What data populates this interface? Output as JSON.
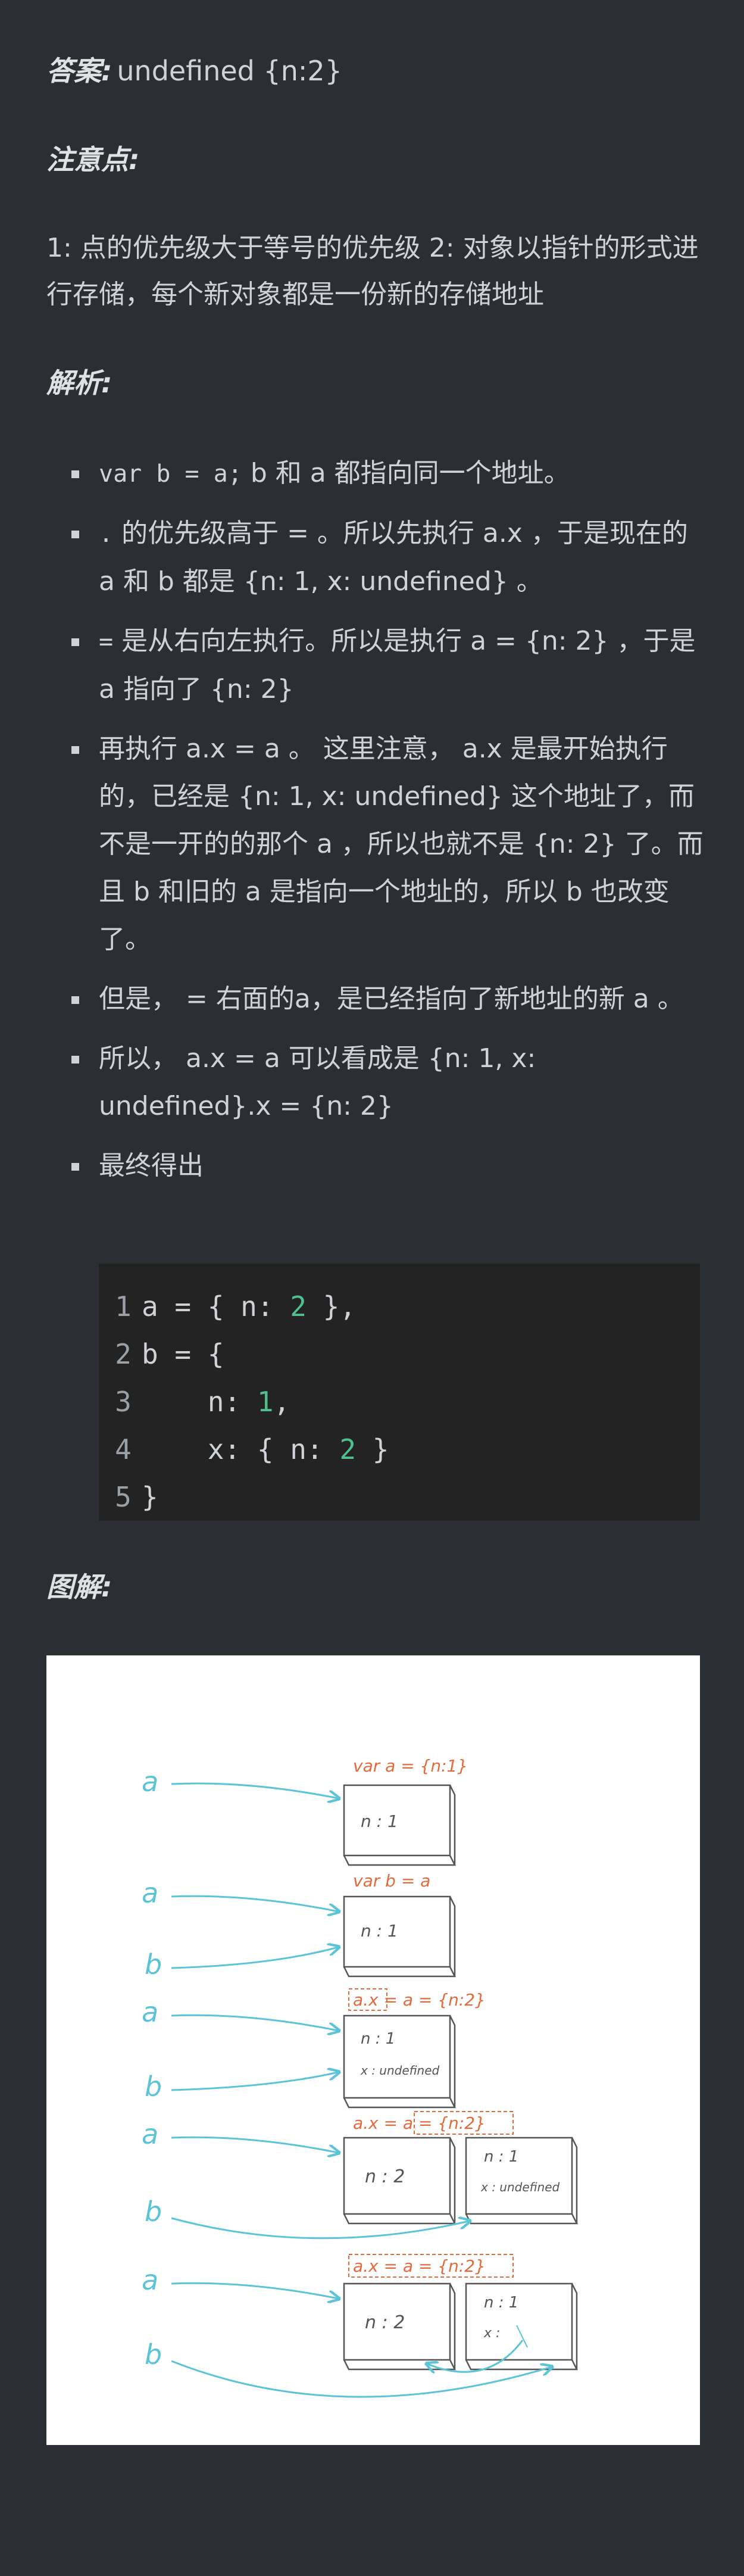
{
  "answer": {
    "label": "答案:",
    "value": "undefined {n:2}"
  },
  "notes": {
    "label": "注意点:",
    "text": "1: 点的优先级大于等号的优先级 2: 对象以指针的形式进行存储，每个新对象都是一份新的存储地址"
  },
  "analysis": {
    "label": "解析:",
    "items": [
      {
        "code": "var b = a;",
        "text": " b 和 a 都指向同一个地址。"
      },
      {
        "code": ".",
        "text": " 的优先级高于 = 。所以先执行 a.x ，于是现在的 a 和 b 都是 {n: 1, x: undefined} 。"
      },
      {
        "code": "=",
        "text": " 是从右向左执行。所以是执行 a = {n: 2} ，于是 a 指向了 {n: 2}"
      },
      {
        "code": "",
        "text": "再执行 a.x = a 。 这里注意， a.x 是最开始执行的，已经是 {n: 1, x: undefined} 这个地址了，而不是一开的的那个 a ，所以也就不是 {n: 2} 了。而且 b 和旧的 a 是指向一个地址的，所以 b 也改变了。"
      },
      {
        "code": "",
        "text": "但是， = 右面的a，是已经指向了新地址的新 a 。"
      },
      {
        "code": "",
        "text": "所以， a.x = a 可以看成是 {n: 1, x: undefined}.x = {n: 2}"
      },
      {
        "code": "",
        "text": "最终得出"
      }
    ],
    "code_lines": [
      {
        "no": "1",
        "parts": [
          "a = { n: ",
          "2",
          " },"
        ]
      },
      {
        "no": "2",
        "parts": [
          "b = {",
          "",
          ""
        ]
      },
      {
        "no": "3",
        "parts": [
          "    n: ",
          "1",
          ","
        ]
      },
      {
        "no": "4",
        "parts": [
          "    x: { n: ",
          "2",
          " }"
        ]
      },
      {
        "no": "5",
        "parts": [
          "}",
          "",
          ""
        ]
      }
    ]
  },
  "figure": {
    "label": "图解:",
    "var_a": "var a = {n:1}",
    "var_b": "var b = a",
    "stmt": "a.x = a = {n:2}",
    "box_n1": "n : 1",
    "box_n2": "n : 2",
    "box_x_undef": "x : undefined",
    "box_x": "x :",
    "letter_a": "a",
    "letter_b": "b",
    "colors": {
      "ink": "#555555",
      "arrow": "#5cc4d6",
      "label": "#e46a3c"
    }
  }
}
